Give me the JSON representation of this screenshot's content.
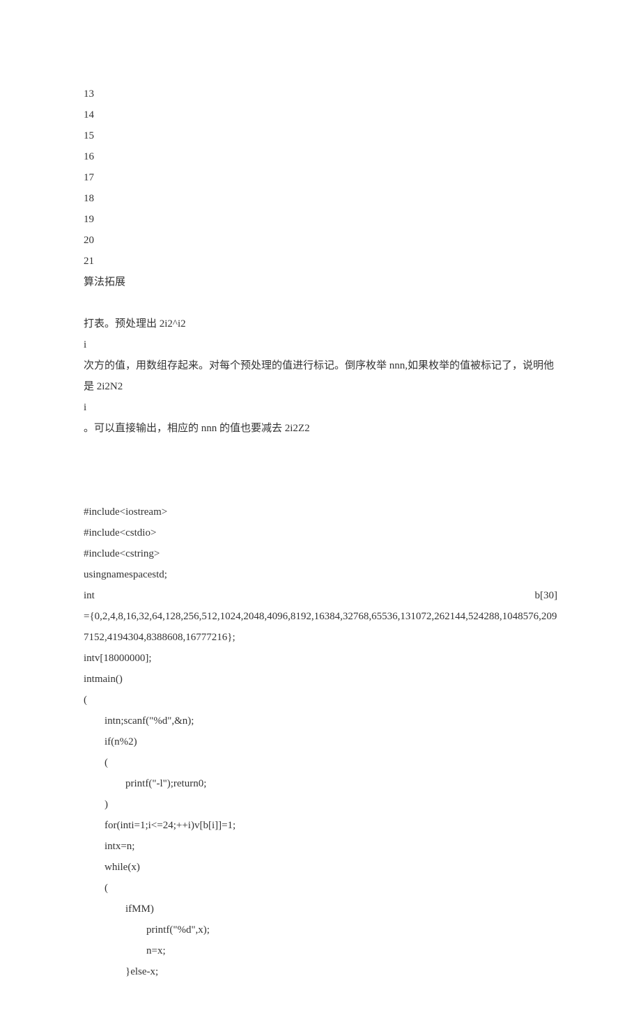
{
  "lines": [
    "13",
    "14",
    "15",
    "16",
    "17",
    "18",
    "19",
    "20",
    "21",
    "算法拓展"
  ],
  "para1": [
    "打表。预处理出 2i2^i2",
    "i",
    "次方的值，用数组存起来。对每个预处理的值进行标记。倒序枚举 nnn,如果枚举的值被标记了，说明他是 2i2N2",
    "i",
    "。可以直接输出，相应的 nnn 的值也要减去 2i2Z2"
  ],
  "code": [
    "#include<iostream>",
    "#include<cstdio>",
    "#include<cstring>",
    "usingnamespacestd;",
    "int                                                                                                                                                                        b[30]",
    "={0,2,4,8,16,32,64,128,256,512,1024,2048,4096,8192,16384,32768,65536,131072,262144,524288,1048576,2097152,4194304,8388608,16777216};",
    "intv[18000000];",
    "intmain()",
    "(",
    "        intn;scanf(\"%d\",&n);",
    "        if(n%2)",
    "        (",
    "                printf(\"-l\");return0;",
    "        )",
    "        for(inti=1;i<=24;++i)v[b[i]]=1;",
    "        intx=n;",
    "        while(x)",
    "        (",
    "                ifMM)",
    "",
    "                        printf(\"%d\",x);",
    "                        n=x;",
    "                }else-x;"
  ]
}
